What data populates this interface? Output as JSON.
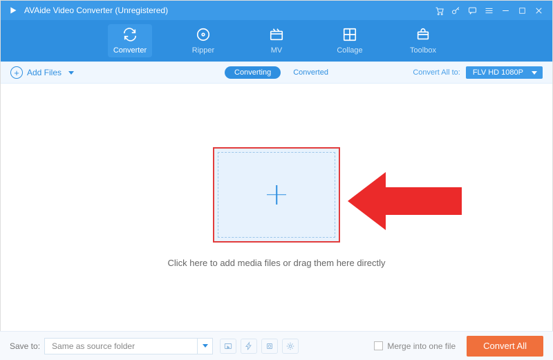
{
  "title": "AVAide Video Converter (Unregistered)",
  "nav": {
    "converter": "Converter",
    "ripper": "Ripper",
    "mv": "MV",
    "collage": "Collage",
    "toolbox": "Toolbox"
  },
  "subbar": {
    "add_files": "Add Files",
    "converting": "Converting",
    "converted": "Converted",
    "convert_all_to": "Convert All to:",
    "format": "FLV HD 1080P"
  },
  "workarea": {
    "hint": "Click here to add media files or drag them here directly"
  },
  "bottombar": {
    "save_to_label": "Save to:",
    "save_to_value": "Same as source folder",
    "merge_label": "Merge into one file",
    "convert_all": "Convert All"
  }
}
